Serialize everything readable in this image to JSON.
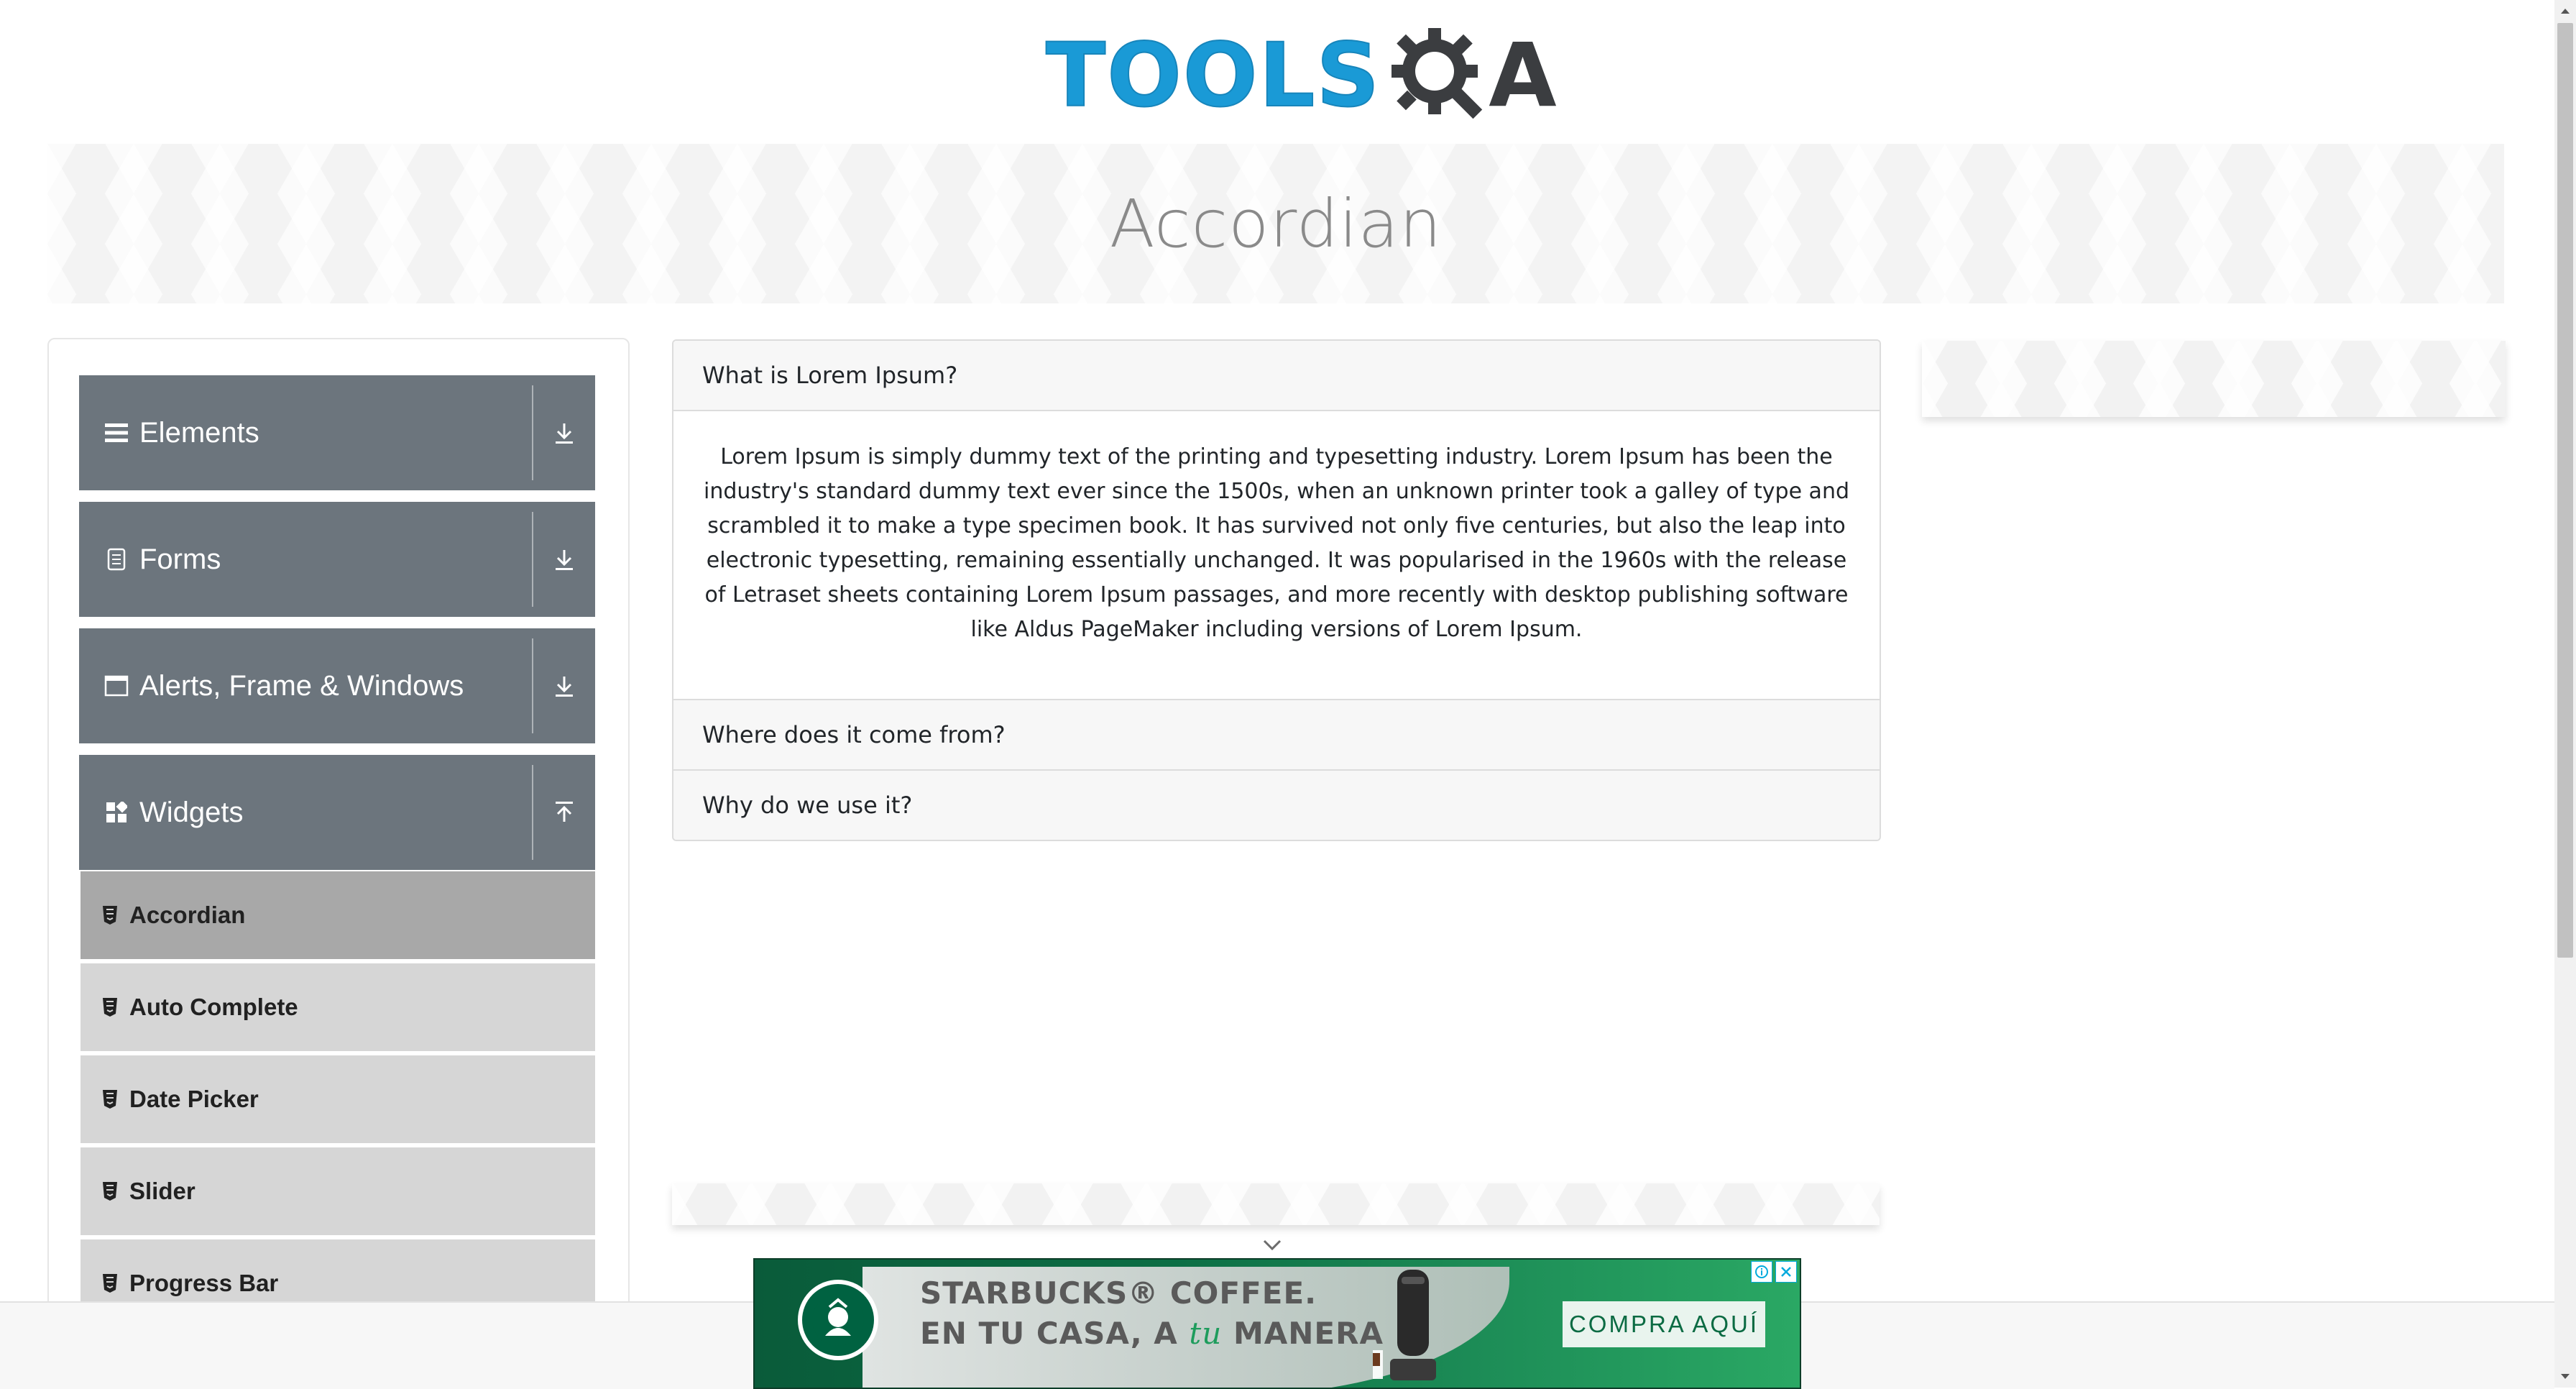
{
  "logo": {
    "tools": "TOOLS",
    "a": "A",
    "colors": {
      "blue": "#1a9ad6",
      "dark": "#3b3d40"
    }
  },
  "page": {
    "title": "Accordian"
  },
  "sidebar": {
    "groups": [
      {
        "label": "Elements",
        "icon": "menu-icon",
        "toggle": "download-arrow-icon"
      },
      {
        "label": "Forms",
        "icon": "document-icon",
        "toggle": "download-arrow-icon"
      },
      {
        "label": "Alerts, Frame & Windows",
        "icon": "window-icon",
        "toggle": "download-arrow-icon"
      },
      {
        "label": "Widgets",
        "icon": "grid-icon",
        "toggle": "upload-arrow-icon"
      }
    ],
    "widgets_items": [
      {
        "label": "Accordian",
        "active": true
      },
      {
        "label": "Auto Complete"
      },
      {
        "label": "Date Picker"
      },
      {
        "label": "Slider"
      },
      {
        "label": "Progress Bar"
      }
    ]
  },
  "accordion": {
    "sections": [
      {
        "header": "What is Lorem Ipsum?",
        "expanded": true
      },
      {
        "header": "Where does it come from?"
      },
      {
        "header": "Why do we use it?"
      }
    ],
    "content": "Lorem Ipsum is simply dummy text of the printing and typesetting industry. Lorem Ipsum has been the industry's standard dummy text ever since the 1500s, when an unknown printer took a galley of type and scrambled it to make a type specimen book. It has survived not only five centuries, but also the leap into electronic typesetting, remaining essentially unchanged. It was popularised in the 1960s with the release of Letraset sheets containing Lorem Ipsum passages, and more recently with desktop publishing software like Aldus PageMaker including versions of Lorem Ipsum."
  },
  "ad": {
    "line1": "STARBUCKS® COFFEE.",
    "line2_prefix": "EN TU CASA, A ",
    "line2_italic": "tu",
    "line2_suffix": " MANERA",
    "cta": "COMPRA AQUÍ",
    "colors": {
      "green": "#0c6e45",
      "accent": "#1e9c5c"
    }
  }
}
